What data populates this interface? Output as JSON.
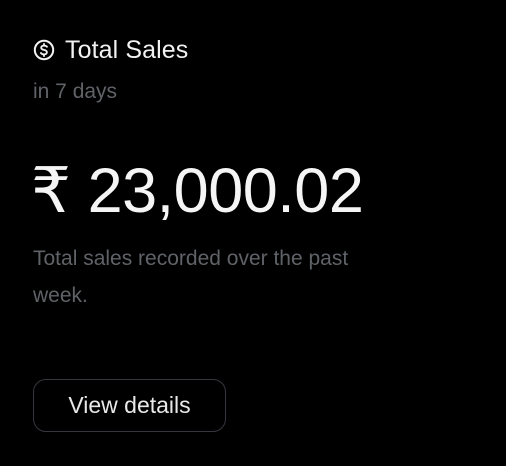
{
  "card": {
    "icon": "dollar-circle-icon",
    "title": "Total Sales",
    "subtitle": "in 7 days",
    "amount": "₹ 23,000.02",
    "description": "Total sales recorded over the past week.",
    "button_label": "View details"
  },
  "colors": {
    "background": "#000000",
    "primary_text": "#f2f2f2",
    "muted_text": "#5f6267",
    "button_border": "#34373c"
  }
}
